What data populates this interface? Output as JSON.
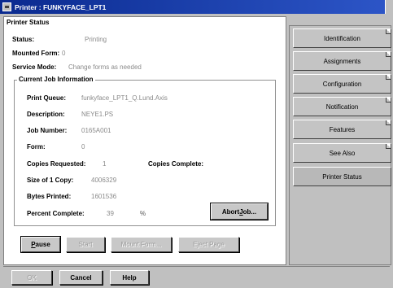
{
  "window": {
    "title": "Printer : FUNKYFACE_LPT1"
  },
  "status_section": {
    "title": "Printer Status",
    "fields": {
      "status": {
        "label": "Status:",
        "value": "Printing"
      },
      "mounted_form": {
        "label": "Mounted Form:",
        "value": "0"
      },
      "service_mode": {
        "label": "Service Mode:",
        "value": "Change forms as needed"
      }
    }
  },
  "job_group": {
    "title": "Current Job Information",
    "fields": {
      "print_queue": {
        "label": "Print Queue:",
        "value": "funkyface_LPT1_Q.Lund.Axis"
      },
      "description": {
        "label": "Description:",
        "value": "NEYE1.PS"
      },
      "job_number": {
        "label": "Job Number:",
        "value": "0165A001"
      },
      "form": {
        "label": "Form:",
        "value": "0"
      },
      "copies_requested": {
        "label": "Copies Requested:",
        "value": "1"
      },
      "copies_complete": {
        "label": "Copies Complete:",
        "value": ""
      },
      "size_of_copy": {
        "label": "Size of 1 Copy:",
        "value": "4006329"
      },
      "bytes_printed": {
        "label": "Bytes Printed:",
        "value": "1601536"
      },
      "percent_complete": {
        "label": "Percent Complete:",
        "value": "39",
        "unit": "%"
      }
    },
    "abort_button": {
      "prefix": "Abort ",
      "accel": "J",
      "suffix": "ob..."
    }
  },
  "action_buttons": {
    "pause": {
      "accel": "P",
      "rest": "ause"
    },
    "start": "Start",
    "mount_form": "Mount Form...",
    "eject_page": "Eject Page"
  },
  "dialog_buttons": {
    "ok": "OK",
    "cancel": "Cancel",
    "help": "Help"
  },
  "tabs": [
    {
      "label": "Identification"
    },
    {
      "label": "Assignments"
    },
    {
      "label": "Configuration"
    },
    {
      "label": "Notification"
    },
    {
      "label": "Features"
    },
    {
      "label": "See Also"
    },
    {
      "label": "Printer Status",
      "active": true
    }
  ]
}
